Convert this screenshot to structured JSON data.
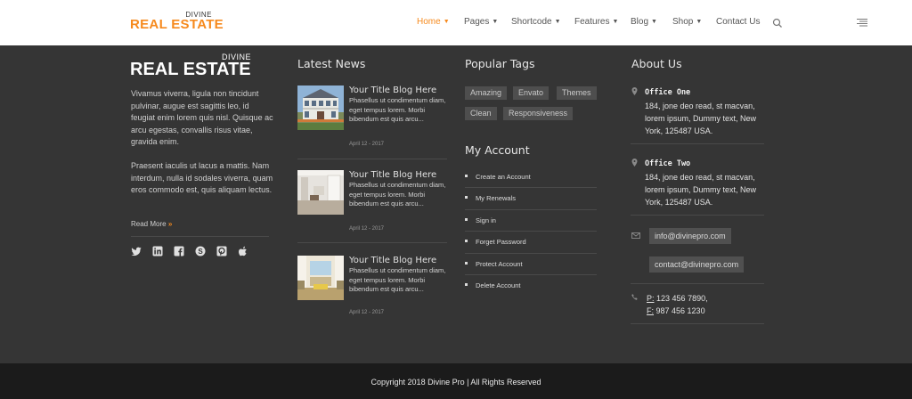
{
  "header": {
    "logo_small": "DIVINE",
    "logo_main": "REAL ESTATE",
    "nav": [
      {
        "label": "Home",
        "dropdown": true,
        "active": true
      },
      {
        "label": "Pages",
        "dropdown": true
      },
      {
        "label": "Shortcode",
        "dropdown": true
      },
      {
        "label": "Features",
        "dropdown": true
      },
      {
        "label": "Blog",
        "dropdown": true
      },
      {
        "label": "Shop",
        "dropdown": true
      },
      {
        "label": "Contact Us",
        "dropdown": false
      }
    ],
    "search_icon": "search-icon",
    "menu_icon": "hamburger-menu-icon"
  },
  "footer": {
    "about": {
      "logo_small": "DIVINE",
      "logo_main": "REAL ESTATE",
      "paragraph1": "Vivamus viverra, ligula non tincidunt pulvinar, augue est sagittis leo, id feugiat enim lorem quis nisl. Quisque ac arcu egestas, convallis risus vitae, gravida enim.",
      "paragraph2": "Praesent iaculis ut lacus a mattis. Nam interdum, nulla id sodales viverra, quam eros commodo est, quis aliquam lectus.",
      "read_more": "Read More",
      "read_more_arrow": "»",
      "socials": [
        "twitter-icon",
        "linkedin-icon",
        "facebook-icon",
        "skype-icon",
        "pinterest-icon",
        "apple-icon"
      ]
    },
    "news": {
      "title": "Latest News",
      "items": [
        {
          "title": "Your Title Blog Here",
          "desc": "Phasellus ut condimentum diam, eget tempus lorem. Morbi bibendum est quis arcu...",
          "date": "April 12 - 2017"
        },
        {
          "title": "Your Title Blog Here",
          "desc": "Phasellus ut condimentum diam, eget tempus lorem. Morbi bibendum est quis arcu...",
          "date": "April 12 - 2017"
        },
        {
          "title": "Your Title Blog Here",
          "desc": "Phasellus ut condimentum diam, eget tempus lorem. Morbi bibendum est quis arcu...",
          "date": "April 12 - 2017"
        }
      ]
    },
    "tags": {
      "title": "Popular Tags",
      "items": [
        "Amazing",
        "Envato",
        "Themes",
        "Clean",
        "Responsiveness"
      ]
    },
    "account": {
      "title": "My Account",
      "items": [
        "Create an Account",
        "My Renewals",
        "Sign in",
        "Forget Password",
        "Protect Account",
        "Delete Account"
      ]
    },
    "contact": {
      "title": "About Us",
      "offices": [
        {
          "name": "Office One",
          "address": "184, jone deo read, st macvan, lorem ipsum, Dummy text, New York, 125487 USA."
        },
        {
          "name": "Office Two",
          "address": "184, jone deo read, st macvan, lorem ipsum, Dummy text, New York, 125487 USA."
        }
      ],
      "emails": [
        "info@divinepro.com",
        "contact@divinepro.com"
      ],
      "phone_label": "P:",
      "phone": "123 456 7890,",
      "fax_label": "F:",
      "fax": "987 456 1230"
    }
  },
  "bottom": {
    "copyright": "Copyright 2018 Divine Pro | All Rights Reserved"
  },
  "colors": {
    "accent": "#f68a1e",
    "footer_bg": "#353535",
    "bottom_bg": "#1b1b1b"
  }
}
